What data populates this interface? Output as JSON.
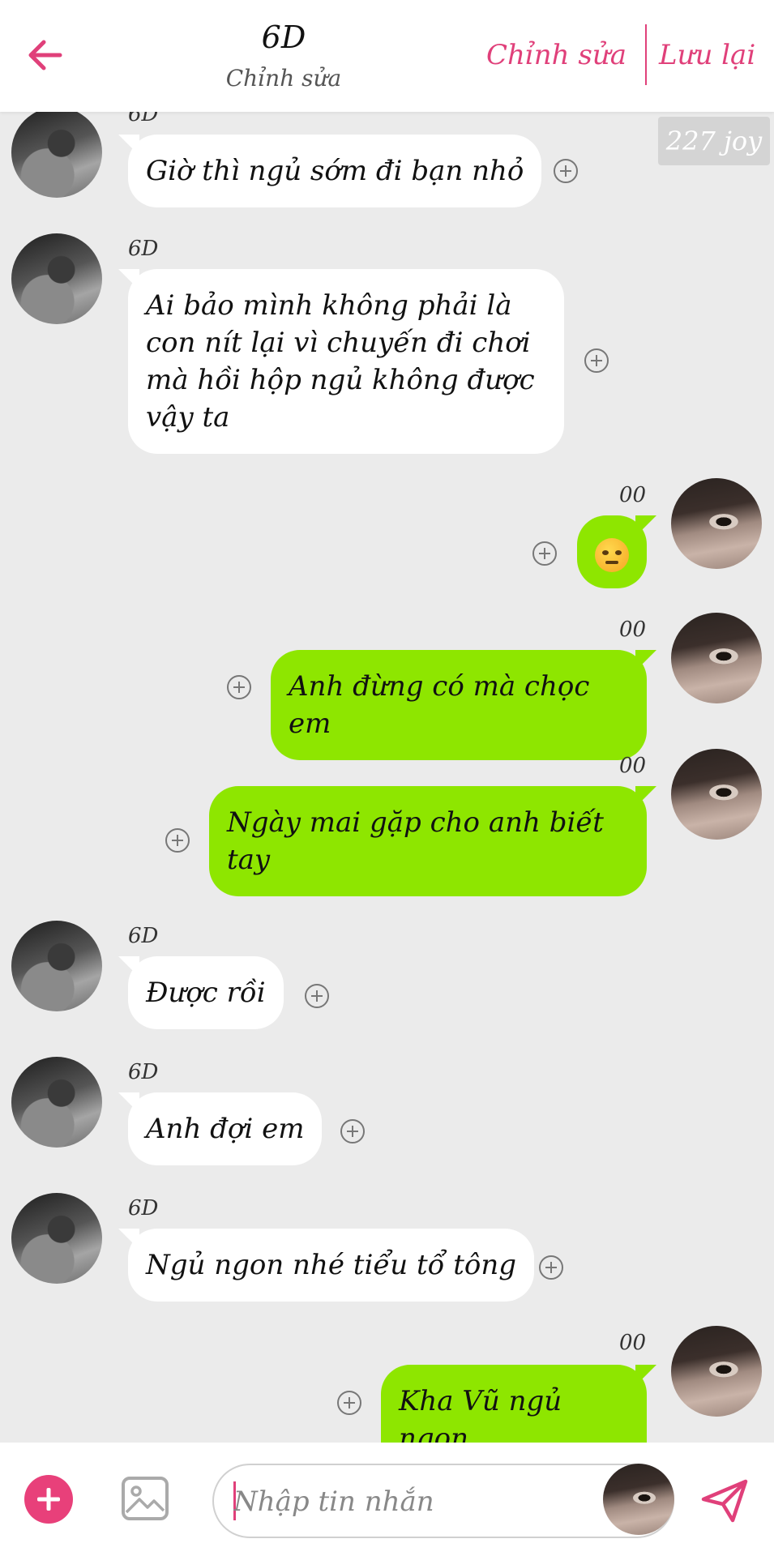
{
  "header": {
    "title": "6D",
    "subtitle": "Chỉnh sửa",
    "edit_label": "Chỉnh sửa",
    "save_label": "Lưu lại"
  },
  "watermark": "227 joy",
  "messages": [
    {
      "side": "in",
      "sender": "6D",
      "text": "Giờ thì ngủ sớm đi bạn nhỏ"
    },
    {
      "side": "in",
      "sender": "6D",
      "text": "Ai bảo mình không phải là con nít lại vì chuyến đi chơi mà hồi hộp ngủ không được vậy ta"
    },
    {
      "side": "out",
      "sender": "00",
      "text": "",
      "emoji": "angry-face"
    },
    {
      "side": "out",
      "sender": "00",
      "text": "Anh đừng có mà chọc em"
    },
    {
      "side": "out",
      "sender": "00",
      "text": "Ngày mai gặp cho anh biết tay"
    },
    {
      "side": "in",
      "sender": "6D",
      "text": "Được rồi"
    },
    {
      "side": "in",
      "sender": "6D",
      "text": "Anh đợi em"
    },
    {
      "side": "in",
      "sender": "6D",
      "text": "Ngủ ngon nhé tiểu tổ tông"
    },
    {
      "side": "out",
      "sender": "00",
      "text": "Kha Vũ ngủ ngon"
    }
  ],
  "composer": {
    "placeholder": "Nhập tin nhắn",
    "value": ""
  },
  "colors": {
    "accent": "#e0407a",
    "outgoing_bubble": "#8ee600",
    "incoming_bubble": "#ffffff",
    "background": "#ebebeb"
  },
  "icons": [
    "back-arrow-icon",
    "add-icon",
    "image-icon",
    "send-icon",
    "add-reaction-icon",
    "angry-face-emoji"
  ]
}
